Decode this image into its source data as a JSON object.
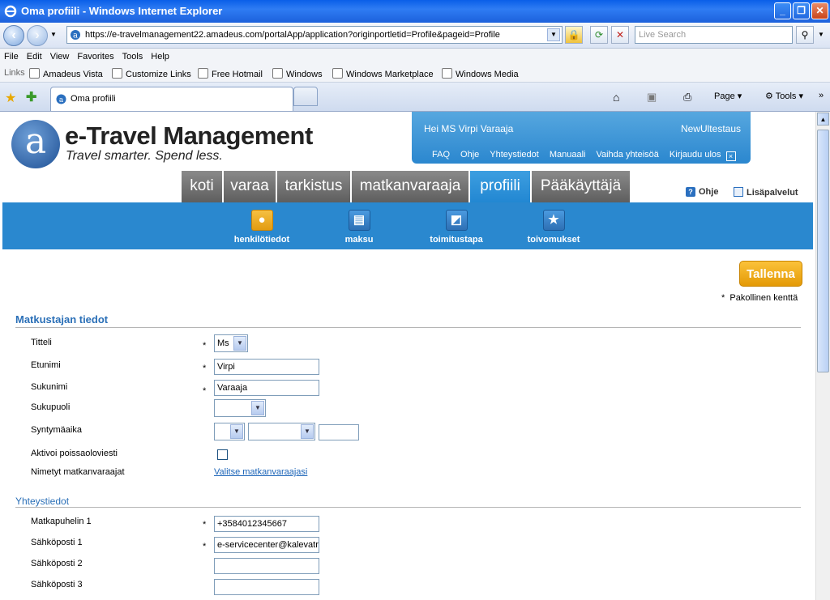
{
  "browser": {
    "title": "Oma profiili - Windows Internet Explorer",
    "url": "https://e-travelmanagement22.amadeus.com/portalApp/application?originportletid=Profile&pageid=Profile",
    "search_placeholder": "Live Search",
    "menu": [
      "File",
      "Edit",
      "View",
      "Favorites",
      "Tools",
      "Help"
    ],
    "links_label": "Links",
    "links": [
      "Amadeus Vista",
      "Customize Links",
      "Free Hotmail",
      "Windows",
      "Windows Marketplace",
      "Windows Media"
    ],
    "tab_title": "Oma profiili",
    "toolbar": {
      "page": "Page",
      "tools": "Tools"
    }
  },
  "header": {
    "logo_letter": "a",
    "brand": "e-Travel Management",
    "tagline": "Travel smarter. Spend less.",
    "greeting": "Hei MS Virpi Varaaja",
    "org": "NewUltestaus",
    "user_links": [
      "FAQ",
      "Ohje",
      "Yhteystiedot",
      "Manuaali",
      "Vaihda yhteisöä",
      "Kirjaudu ulos"
    ],
    "close_glyph": "×",
    "help": "Ohje",
    "extra": "Lisäpalvelut"
  },
  "main_tabs": [
    "koti",
    "varaa",
    "tarkistus",
    "matkanvaraaja",
    "profiili",
    "Pääkäyttäjä"
  ],
  "active_tab": "profiili",
  "subnav": [
    "henkilötiedot",
    "maksu",
    "toimitustapa",
    "toivomukset"
  ],
  "form": {
    "save": "Tallenna",
    "mandatory_note": "Pakollinen kenttä",
    "star": "*",
    "section1": "Matkustajan tiedot",
    "labels1": [
      "Titteli",
      "Etunimi",
      "Sukunimi",
      "Sukupuoli",
      "Syntymäaika",
      "Aktivoi poissaoloviesti",
      "Nimetyt matkanvaraajat"
    ],
    "title_value": "Ms",
    "first_name": "Virpi",
    "last_name": "Varaaja",
    "choose_agents_link": "Valitse matkanvaraajasi",
    "section2": "Yhteystiedot",
    "labels2": [
      "Matkapuhelin 1",
      "Sähköposti 1",
      "Sähköposti 2",
      "Sähköposti 3"
    ],
    "mobile1": "+3584012345667",
    "email1": "e-servicecenter@kalevatravel.fi",
    "email2": "",
    "email3": ""
  }
}
